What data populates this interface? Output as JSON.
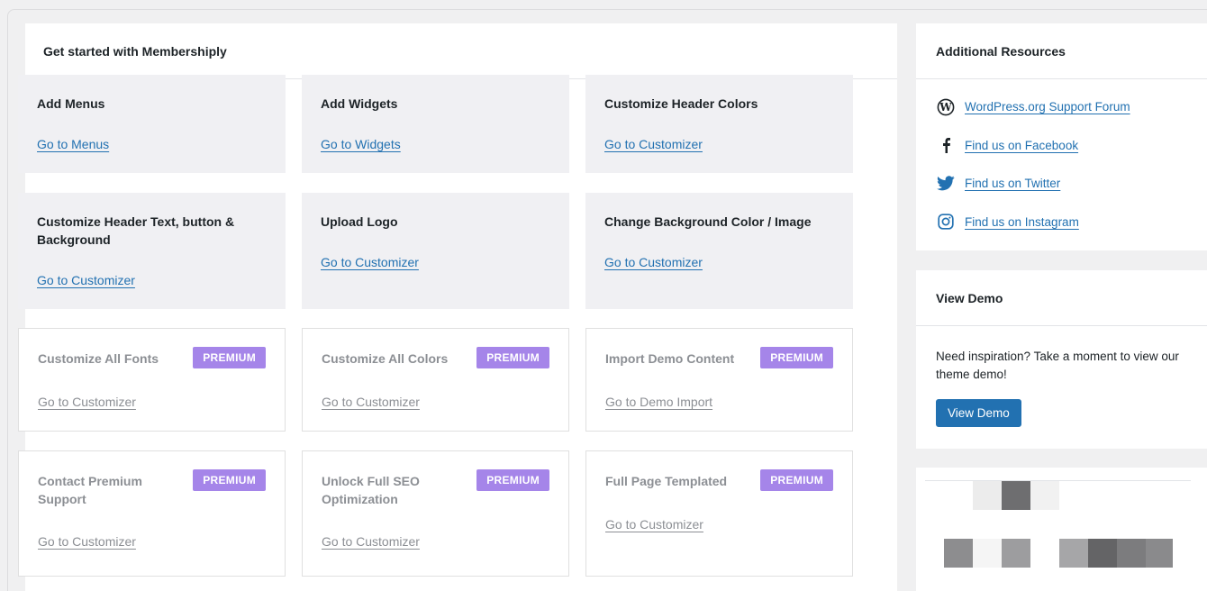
{
  "main": {
    "title": "Get started with Membershiply",
    "cards": [
      {
        "title": "Add Menus",
        "link": "Go to Menus"
      },
      {
        "title": "Add Widgets",
        "link": "Go to Widgets"
      },
      {
        "title": "Customize Header Colors",
        "link": "Go to Customizer"
      },
      {
        "title": "Customize Header Text, button & Background",
        "link": "Go to Customizer"
      },
      {
        "title": "Upload Logo",
        "link": "Go to Customizer"
      },
      {
        "title": "Change Background Color / Image",
        "link": "Go to Customizer"
      },
      {
        "title": "Customize All Fonts",
        "link": "Go to Customizer",
        "badge": "PREMIUM"
      },
      {
        "title": "Customize All Colors",
        "link": "Go to Customizer",
        "badge": "PREMIUM"
      },
      {
        "title": "Import Demo Content",
        "link": "Go to Demo Import",
        "badge": "PREMIUM"
      },
      {
        "title": "Contact Premium Support",
        "link": "Go to Customizer",
        "badge": "PREMIUM"
      },
      {
        "title": "Unlock Full SEO Optimization",
        "link": "Go to Customizer",
        "badge": "PREMIUM"
      },
      {
        "title": "Full Page Templated",
        "link": "Go to Customizer",
        "badge": "PREMIUM"
      }
    ]
  },
  "resources": {
    "title": "Additional Resources",
    "items": [
      {
        "icon": "wordpress-icon",
        "label": "WordPress.org Support Forum"
      },
      {
        "icon": "facebook-icon",
        "label": "Find us on Facebook"
      },
      {
        "icon": "twitter-icon",
        "label": "Find us on Twitter"
      },
      {
        "icon": "instagram-icon",
        "label": "Find us on Instagram"
      }
    ]
  },
  "demo": {
    "title": "View Demo",
    "text": "Need inspiration? Take a moment to view our theme demo!",
    "button": "View Demo"
  },
  "colors": {
    "accent": "#2271b1",
    "premium_badge": "#a585e9",
    "card_bg": "#f0f0f3"
  }
}
